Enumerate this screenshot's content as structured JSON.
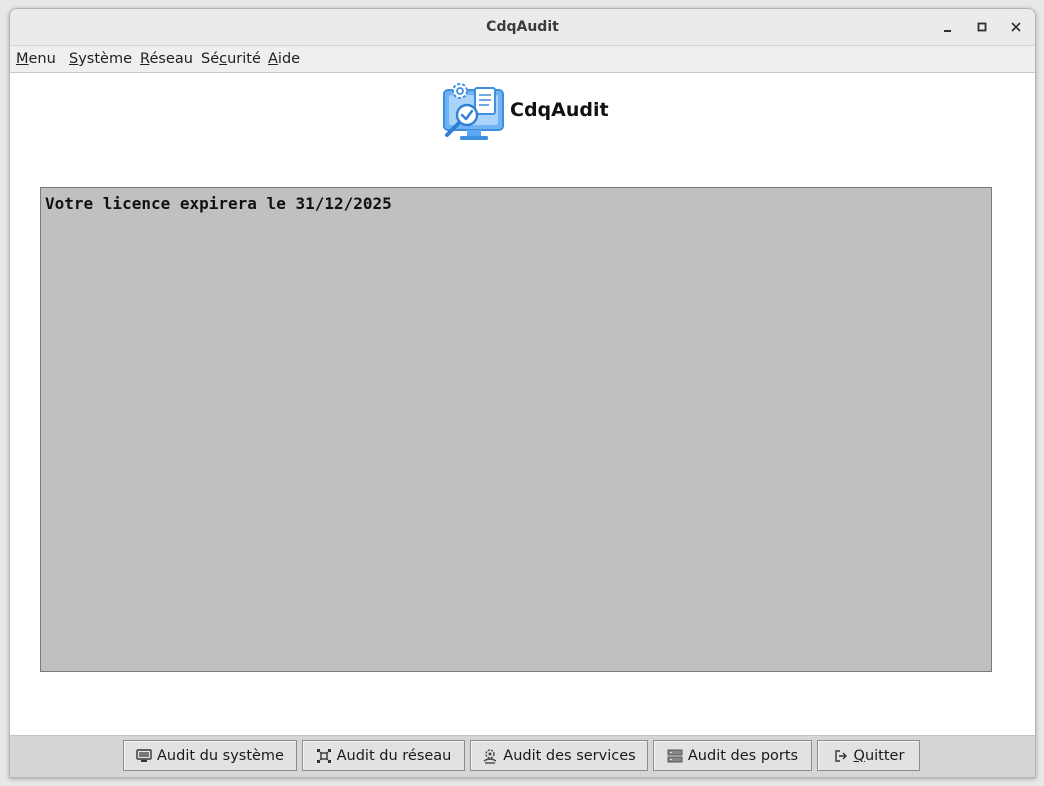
{
  "window": {
    "title": "CdqAudit"
  },
  "menubar": {
    "items": [
      {
        "first": "M",
        "rest": "enu"
      },
      {
        "first": "S",
        "rest": "ystème"
      },
      {
        "first": "R",
        "rest": "éseau"
      },
      {
        "first": "Sé",
        "mid": "c",
        "rest": "urité"
      },
      {
        "first": "A",
        "rest": "ide"
      }
    ]
  },
  "header": {
    "app_name": "CdqAudit",
    "logo_icon": "audit-monitor-icon"
  },
  "output": {
    "text": "Votre licence expirera le 31/12/2025"
  },
  "toolbar": {
    "audit_system": "Audit du système",
    "audit_network": "Audit du réseau",
    "audit_services": "Audit des services",
    "audit_ports": "Audit des ports",
    "quit_first": "Q",
    "quit_rest": "uitter"
  },
  "colors": {
    "output_bg": "#c0c0c0",
    "logo_blue": "#5aa6f0"
  }
}
